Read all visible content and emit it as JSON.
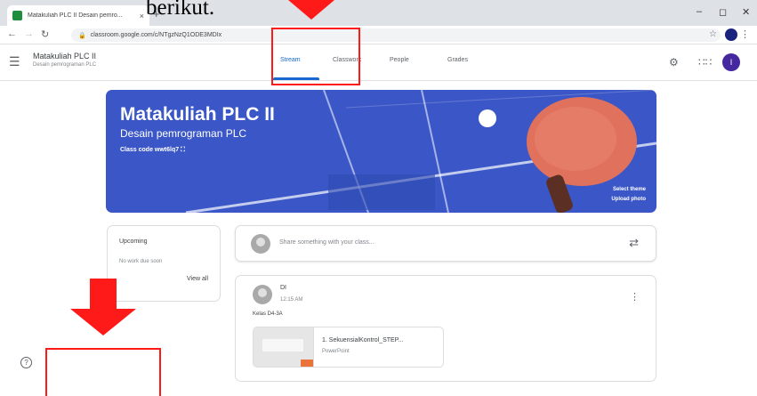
{
  "caption": "berikut.",
  "browser": {
    "tab_title": "Matakuliah PLC II Desain pemro...",
    "tab_close": "×",
    "new_tab": "+",
    "url": "classroom.google.com/c/NTgzNzQ1ODE3MDIx",
    "avatar_letter": "I"
  },
  "app": {
    "class_name": "Matakuliah PLC II",
    "class_subtitle": "Desain pemrograman PLC",
    "tabs": [
      "Stream",
      "Classwork",
      "People",
      "Grades"
    ],
    "active_tab": "Stream",
    "avatar_letter": "I"
  },
  "banner": {
    "title": "Matakuliah PLC II",
    "subtitle": "Desain pemrograman PLC",
    "class_code": "Class code  wwt6lq7",
    "select_theme": "Select theme",
    "upload_photo": "Upload photo"
  },
  "upcoming": {
    "title": "Upcoming",
    "empty": "No work due soon",
    "view_all": "View all"
  },
  "share": {
    "placeholder": "Share something with your class..."
  },
  "post": {
    "author": "DI",
    "time": "12:15 AM",
    "text": "Kelas D4-3A",
    "attachment_name": "1. SekuensialKontrol_STEP...",
    "attachment_type": "PowerPoint"
  },
  "icons": {
    "help": "?",
    "annotation_color": "#ff1a1a",
    "accent": "#1967d2",
    "banner_color": "#3b57c7"
  }
}
